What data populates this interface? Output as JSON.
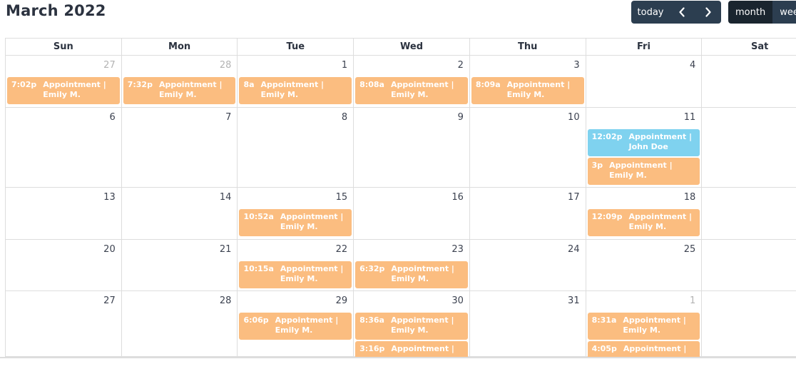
{
  "header": {
    "title": "March 2022",
    "nav": {
      "today_label": "today",
      "prev_icon": "‹",
      "next_icon": "›"
    },
    "views": [
      {
        "label": "month",
        "active": true
      },
      {
        "label": "week",
        "active": false
      }
    ]
  },
  "colors": {
    "event_default": "#fbbd80",
    "event_alt": "#7fd2ef",
    "toolbar_button": "#2c3e50",
    "toolbar_button_active": "#1a252f"
  },
  "weekdays": [
    "Sun",
    "Mon",
    "Tue",
    "Wed",
    "Thu",
    "Fri",
    "Sat"
  ],
  "weeks": [
    [
      {
        "day": "27",
        "other": true,
        "events": [
          {
            "time": "7:02p",
            "title": "Appointment | Emily M."
          }
        ]
      },
      {
        "day": "28",
        "other": true,
        "events": [
          {
            "time": "7:32p",
            "title": "Appointment | Emily M."
          }
        ]
      },
      {
        "day": "1",
        "events": [
          {
            "time": "8a",
            "title": "Appointment | Emily M."
          }
        ]
      },
      {
        "day": "2",
        "events": [
          {
            "time": "8:08a",
            "title": "Appointment | Emily M."
          }
        ]
      },
      {
        "day": "3",
        "events": [
          {
            "time": "8:09a",
            "title": "Appointment | Emily M."
          }
        ]
      },
      {
        "day": "4",
        "events": []
      },
      {
        "day": "",
        "events": []
      }
    ],
    [
      {
        "day": "6",
        "events": []
      },
      {
        "day": "7",
        "events": []
      },
      {
        "day": "8",
        "events": []
      },
      {
        "day": "9",
        "events": []
      },
      {
        "day": "10",
        "events": []
      },
      {
        "day": "11",
        "events": [
          {
            "time": "12:02p",
            "title": "Appointment | John Doe",
            "color": "blue"
          },
          {
            "time": "3p",
            "title": "Appointment | Emily M."
          }
        ]
      },
      {
        "day": "",
        "events": []
      }
    ],
    [
      {
        "day": "13",
        "events": []
      },
      {
        "day": "14",
        "events": []
      },
      {
        "day": "15",
        "events": [
          {
            "time": "10:52a",
            "title": "Appointment | Emily M."
          }
        ]
      },
      {
        "day": "16",
        "events": []
      },
      {
        "day": "17",
        "events": []
      },
      {
        "day": "18",
        "events": [
          {
            "time": "12:09p",
            "title": "Appointment | Emily M."
          }
        ]
      },
      {
        "day": "",
        "events": []
      }
    ],
    [
      {
        "day": "20",
        "events": []
      },
      {
        "day": "21",
        "events": []
      },
      {
        "day": "22",
        "events": [
          {
            "time": "10:15a",
            "title": "Appointment | Emily M."
          }
        ]
      },
      {
        "day": "23",
        "events": [
          {
            "time": "6:32p",
            "title": "Appointment | Emily M."
          }
        ]
      },
      {
        "day": "24",
        "events": []
      },
      {
        "day": "25",
        "events": []
      },
      {
        "day": "",
        "events": []
      }
    ],
    [
      {
        "day": "27",
        "events": []
      },
      {
        "day": "28",
        "events": []
      },
      {
        "day": "29",
        "events": [
          {
            "time": "6:06p",
            "title": "Appointment | Emily M."
          }
        ]
      },
      {
        "day": "30",
        "events": [
          {
            "time": "8:36a",
            "title": "Appointment | Emily M."
          },
          {
            "time": "3:16p",
            "title": "Appointment |"
          }
        ]
      },
      {
        "day": "31",
        "events": []
      },
      {
        "day": "1",
        "other": true,
        "events": [
          {
            "time": "8:31a",
            "title": "Appointment | Emily M."
          },
          {
            "time": "4:05p",
            "title": "Appointment |"
          }
        ]
      },
      {
        "day": "",
        "events": []
      }
    ]
  ]
}
